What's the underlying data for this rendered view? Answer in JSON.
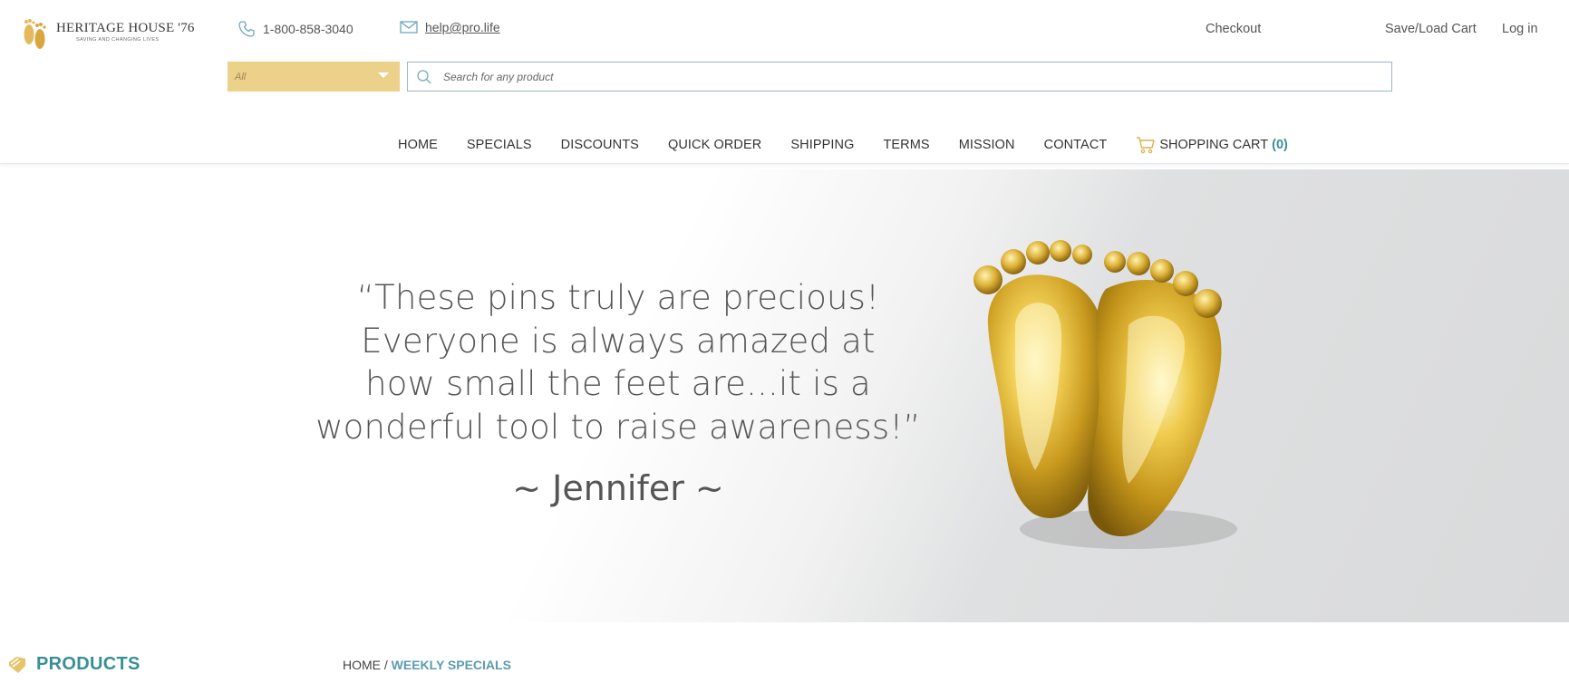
{
  "header": {
    "logo": {
      "name": "HERITAGE HOUSE '76",
      "tagline": "SAVING AND CHANGING LIVES"
    },
    "phone": "1-800-858-3040",
    "email": "help@pro.life",
    "links": {
      "checkout": "Checkout",
      "save_load_cart": "Save/Load Cart",
      "login": "Log in"
    }
  },
  "search": {
    "category": "All",
    "placeholder": "Search for any product"
  },
  "nav": {
    "items": [
      "HOME",
      "SPECIALS",
      "DISCOUNTS",
      "QUICK ORDER",
      "SHIPPING",
      "TERMS",
      "MISSION",
      "CONTACT"
    ],
    "cart_label": "SHOPPING CART",
    "cart_count": "(0)"
  },
  "hero": {
    "quote_lines": [
      "“These pins truly are precious!",
      "Everyone is always amazed at",
      "how small the feet are...it is a",
      "wonderful tool to raise awareness!”"
    ],
    "attribution": "~ Jennifer ~"
  },
  "sidebar": {
    "title": "PRODUCTS"
  },
  "breadcrumb": {
    "home": "HOME",
    "separator": " / ",
    "current": "WEEKLY SPECIALS"
  },
  "colors": {
    "accent_gold": "#ecd18a",
    "accent_teal": "#3a8f95",
    "breadcrumb_blue": "#5a9bb2"
  },
  "icons": {
    "logo": "baby-feet-logo-icon",
    "phone": "phone-icon",
    "email": "envelope-icon",
    "search": "search-icon",
    "dropdown": "caret-down-icon",
    "cart": "cart-icon",
    "products": "tag-icon"
  }
}
